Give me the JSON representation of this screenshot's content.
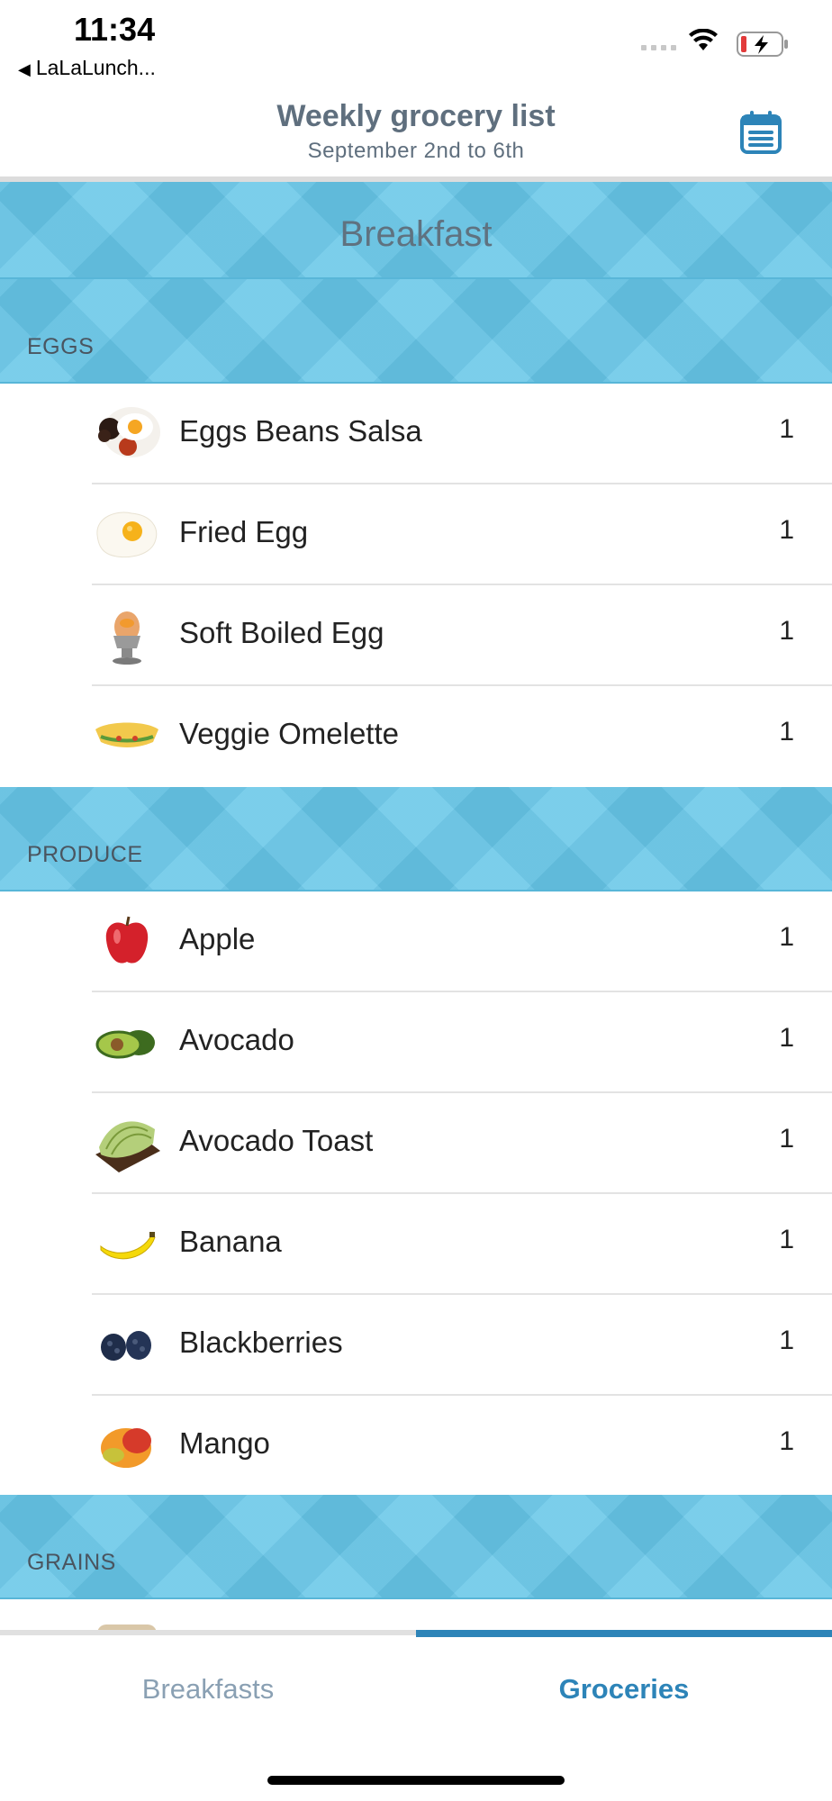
{
  "status_bar": {
    "time": "11:34",
    "back_app": "LaLaLunch...",
    "back_icon": "back-triangle-icon",
    "wifi_icon": "wifi-icon",
    "battery_icon": "battery-charging-icon"
  },
  "header": {
    "title": "Weekly grocery list",
    "subtitle": "September 2nd to 6th",
    "calendar_icon": "calendar-list-icon",
    "accent_color": "#2d84b8"
  },
  "section": {
    "title": "Breakfast"
  },
  "categories": [
    {
      "label": "EGGS",
      "items": [
        {
          "name": "Eggs Beans Salsa",
          "qty": "1",
          "icon": "eggs-beans-salsa-icon"
        },
        {
          "name": "Fried Egg",
          "qty": "1",
          "icon": "fried-egg-icon"
        },
        {
          "name": "Soft Boiled Egg",
          "qty": "1",
          "icon": "soft-boiled-egg-icon"
        },
        {
          "name": "Veggie Omelette",
          "qty": "1",
          "icon": "veggie-omelette-icon"
        }
      ]
    },
    {
      "label": "PRODUCE",
      "items": [
        {
          "name": "Apple",
          "qty": "1",
          "icon": "apple-icon"
        },
        {
          "name": "Avocado",
          "qty": "1",
          "icon": "avocado-icon"
        },
        {
          "name": "Avocado Toast",
          "qty": "1",
          "icon": "avocado-toast-icon"
        },
        {
          "name": "Banana",
          "qty": "1",
          "icon": "banana-icon"
        },
        {
          "name": "Blackberries",
          "qty": "1",
          "icon": "blackberries-icon"
        },
        {
          "name": "Mango",
          "qty": "1",
          "icon": "mango-icon"
        }
      ]
    },
    {
      "label": "GRAINS",
      "items": []
    }
  ],
  "tabs": [
    {
      "label": "Breakfasts",
      "active": false
    },
    {
      "label": "Groceries",
      "active": true
    }
  ],
  "colors": {
    "banner": "#66c6e8",
    "active_tab": "#2d84b8",
    "inactive_tab": "#8aa0b3"
  }
}
